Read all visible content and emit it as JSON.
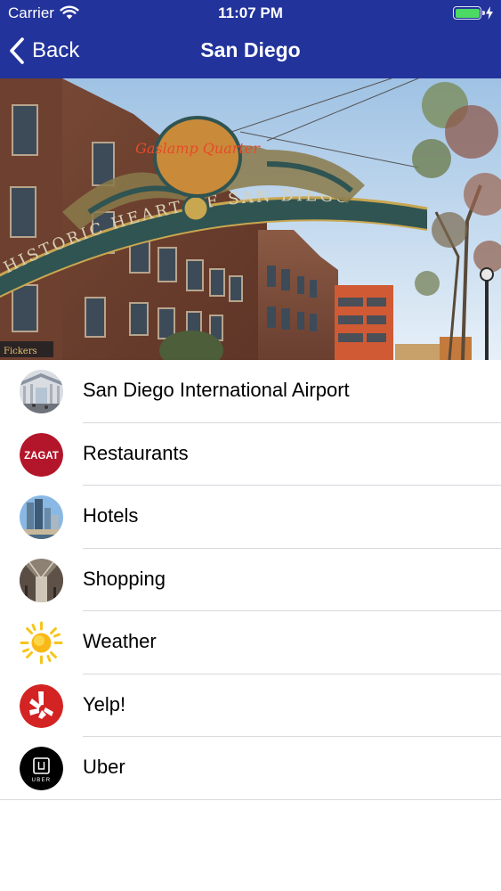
{
  "status_bar": {
    "carrier": "Carrier",
    "time": "11:07 PM",
    "battery_color": "#4cd964"
  },
  "nav": {
    "back_label": "Back",
    "title": "San Diego",
    "bar_color": "#22339b"
  },
  "hero": {
    "sign_top": "Gaslamp Quarter",
    "sign_arch": "HISTORIC HEART OF SAN DIEGO"
  },
  "list": {
    "items": [
      {
        "label": "San Diego International Airport",
        "icon": "airport-thumb-icon"
      },
      {
        "label": "Restaurants",
        "icon": "zagat-logo-icon",
        "logo_text": "ZAGAT"
      },
      {
        "label": "Hotels",
        "icon": "hotels-thumb-icon"
      },
      {
        "label": "Shopping",
        "icon": "shopping-thumb-icon"
      },
      {
        "label": "Weather",
        "icon": "sun-icon"
      },
      {
        "label": "Yelp!",
        "icon": "yelp-logo-icon"
      },
      {
        "label": "Uber",
        "icon": "uber-logo-icon",
        "logo_text": "UBER"
      }
    ]
  }
}
